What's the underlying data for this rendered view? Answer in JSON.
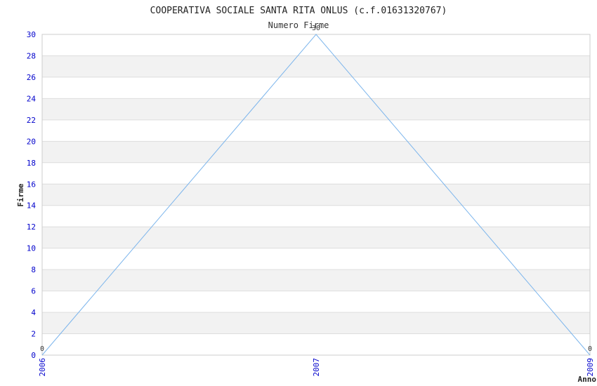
{
  "chart_data": {
    "type": "line",
    "title": "COOPERATIVA SOCIALE SANTA RITA ONLUS (c.f.01631320767)",
    "subtitle": "Numero Firme",
    "xlabel": "Anno",
    "ylabel": "Firme",
    "categories": [
      "2006",
      "2007",
      "2009"
    ],
    "series": [
      {
        "name": "Numero Firme",
        "values": [
          0,
          30,
          0
        ]
      }
    ],
    "ylim": [
      0,
      30
    ],
    "yticks": [
      0,
      2,
      4,
      6,
      8,
      10,
      12,
      14,
      16,
      18,
      20,
      22,
      24,
      26,
      28,
      30
    ],
    "grid": true,
    "colors": {
      "line": "#7cb5ec",
      "tick_label": "#0000cc",
      "band": "#f2f2f2",
      "grid": "#dddddd"
    }
  }
}
